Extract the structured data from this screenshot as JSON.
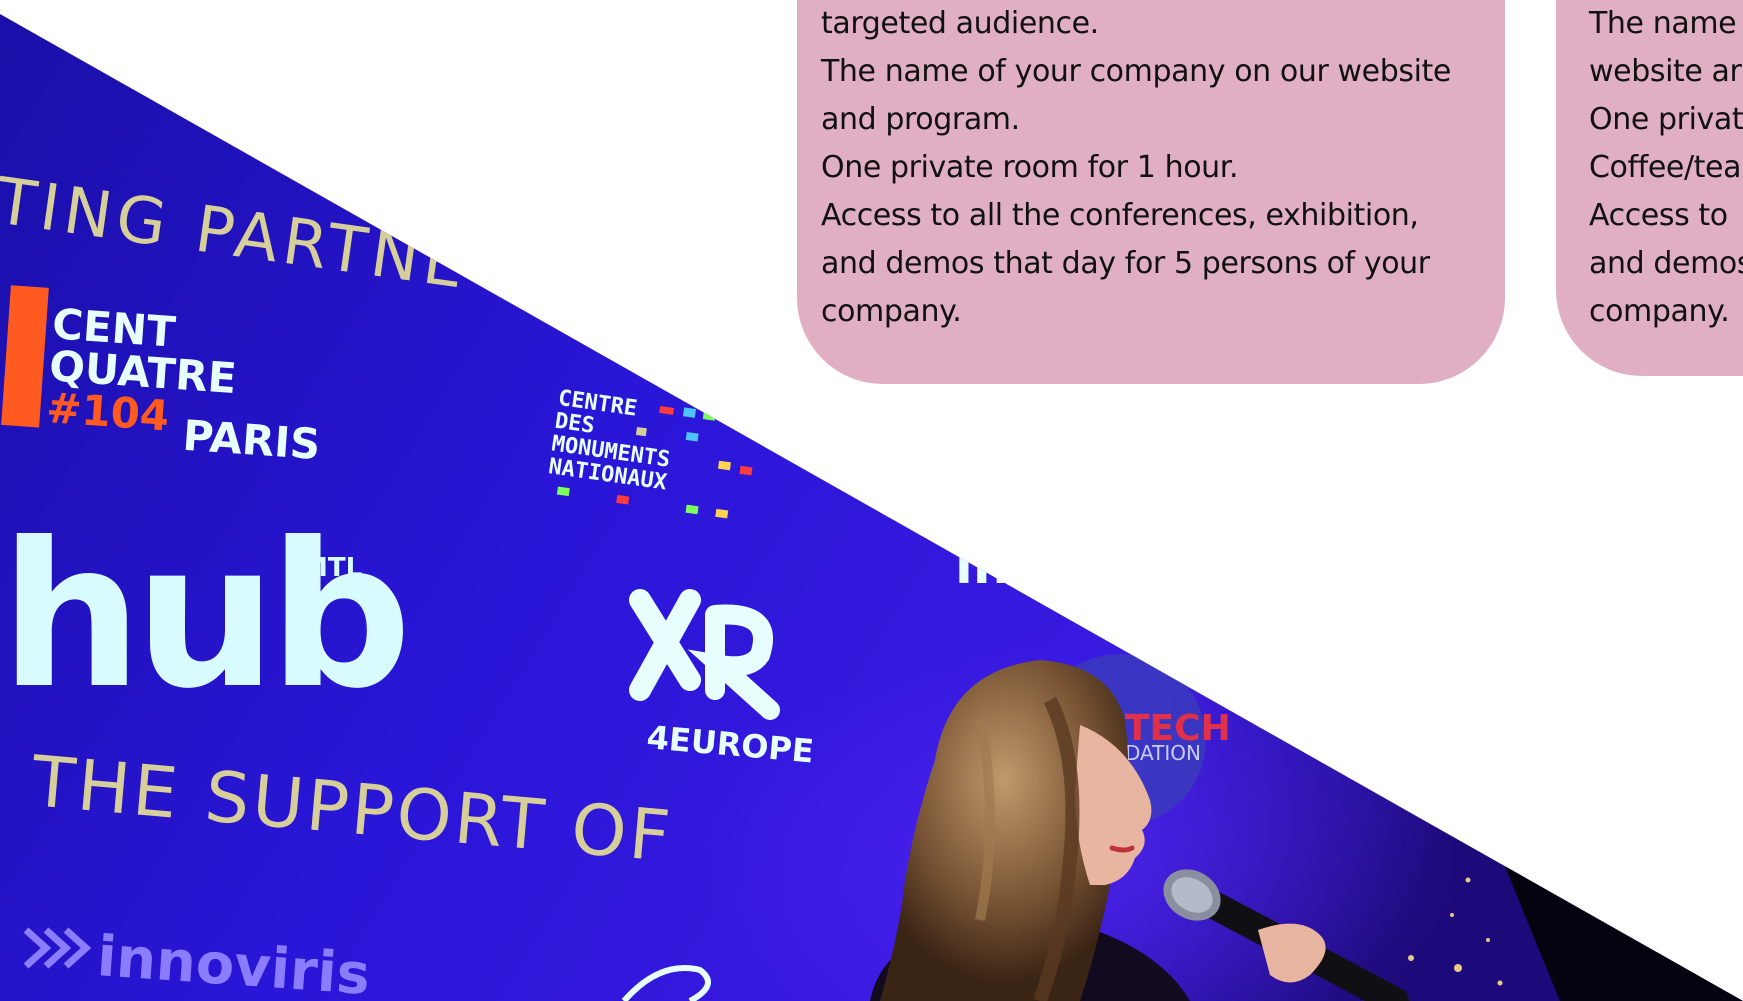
{
  "colors": {
    "card_background": "#e1afc4",
    "page_background": "#ffffff",
    "stage_backdrop": "#2a12d6",
    "text": "#111111"
  },
  "photo": {
    "header_partners": "TING PARTNE",
    "header_support": "THE SUPPORT OF",
    "logos": [
      {
        "name": "cent-quatre-logo",
        "lines": [
          "CENT",
          "QUATRE",
          "#104",
          "PARIS"
        ]
      },
      {
        "name": "hub-mtl-logo",
        "lines": [
          "hub",
          "MTL"
        ]
      },
      {
        "name": "centre-monuments-logo",
        "lines": [
          "CENTRE",
          "DES",
          "MONUMENTS",
          "NATIONAUX"
        ]
      },
      {
        "name": "xr4europe-logo",
        "lines": [
          "XR",
          "4EUROPE"
        ]
      },
      {
        "name": "innoviris-logo",
        "lines": [
          "innoviris"
        ]
      },
      {
        "name": "tech-foundation-logo",
        "lines": [
          "TECH",
          "DATION"
        ]
      }
    ]
  },
  "cards": [
    {
      "lines": [
        "targeted audience.",
        "The name of your company on our website",
        "and program.",
        "One private room for 1 hour.",
        "Access to all the conferences, exhibition,",
        "and demos that day for 5 persons of your",
        "company."
      ]
    },
    {
      "lines": [
        "The name",
        "website ar",
        "One privat",
        "Coffee/tea",
        "Access to",
        "and demos",
        "company."
      ]
    }
  ]
}
